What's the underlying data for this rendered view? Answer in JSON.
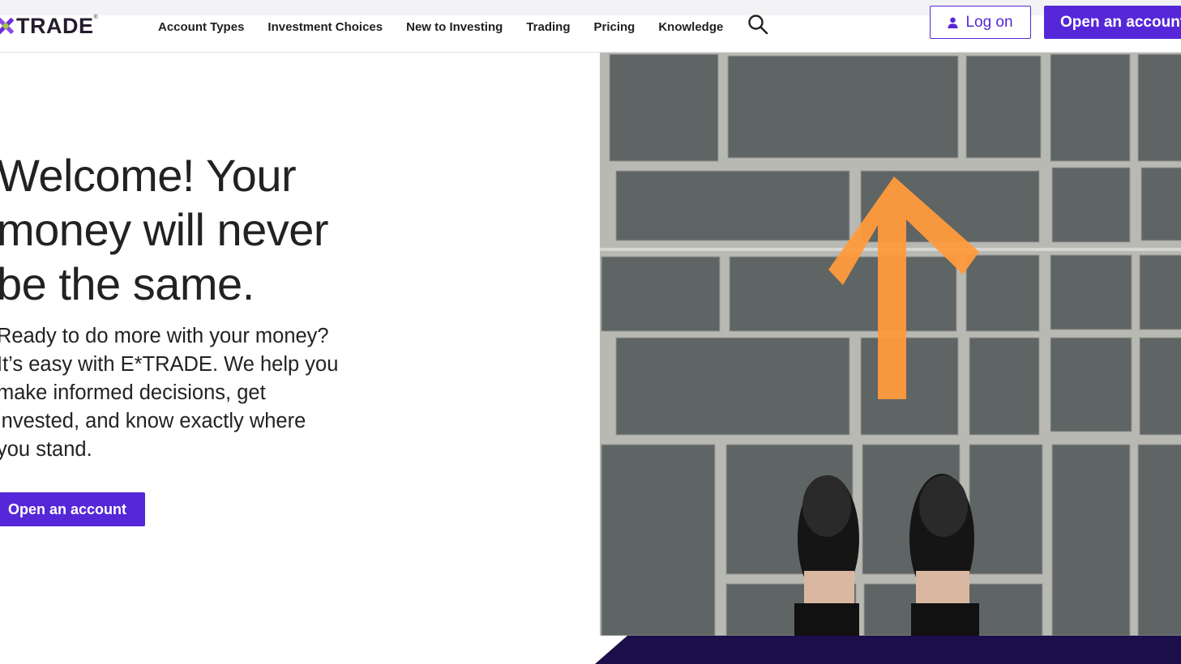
{
  "brand": {
    "logo_text": "TRADE",
    "registered_mark": "®",
    "accent_color": "#5627d8",
    "dark_color": "#1c0e4a",
    "arrow_color": "#ff9a3c"
  },
  "nav": {
    "items": [
      {
        "label": "Account Types"
      },
      {
        "label": "Investment Choices"
      },
      {
        "label": "New to Investing"
      },
      {
        "label": "Trading"
      },
      {
        "label": "Pricing"
      },
      {
        "label": "Knowledge"
      }
    ],
    "search_icon": "search-icon"
  },
  "header_actions": {
    "login_label": "Log on",
    "login_icon": "person-icon",
    "open_account_label": "Open an account"
  },
  "hero": {
    "title_lines": [
      "Welcome! Your",
      "money will never",
      "be the same."
    ],
    "body_lines": [
      "Ready to do more with your money?",
      "It’s easy with E*TRADE. We help you",
      "make informed decisions, get",
      "invested, and know exactly where",
      "you stand."
    ],
    "cta_label": "Open an account",
    "image_subject": "orange-arrow-on-pavement-with-shoes"
  }
}
